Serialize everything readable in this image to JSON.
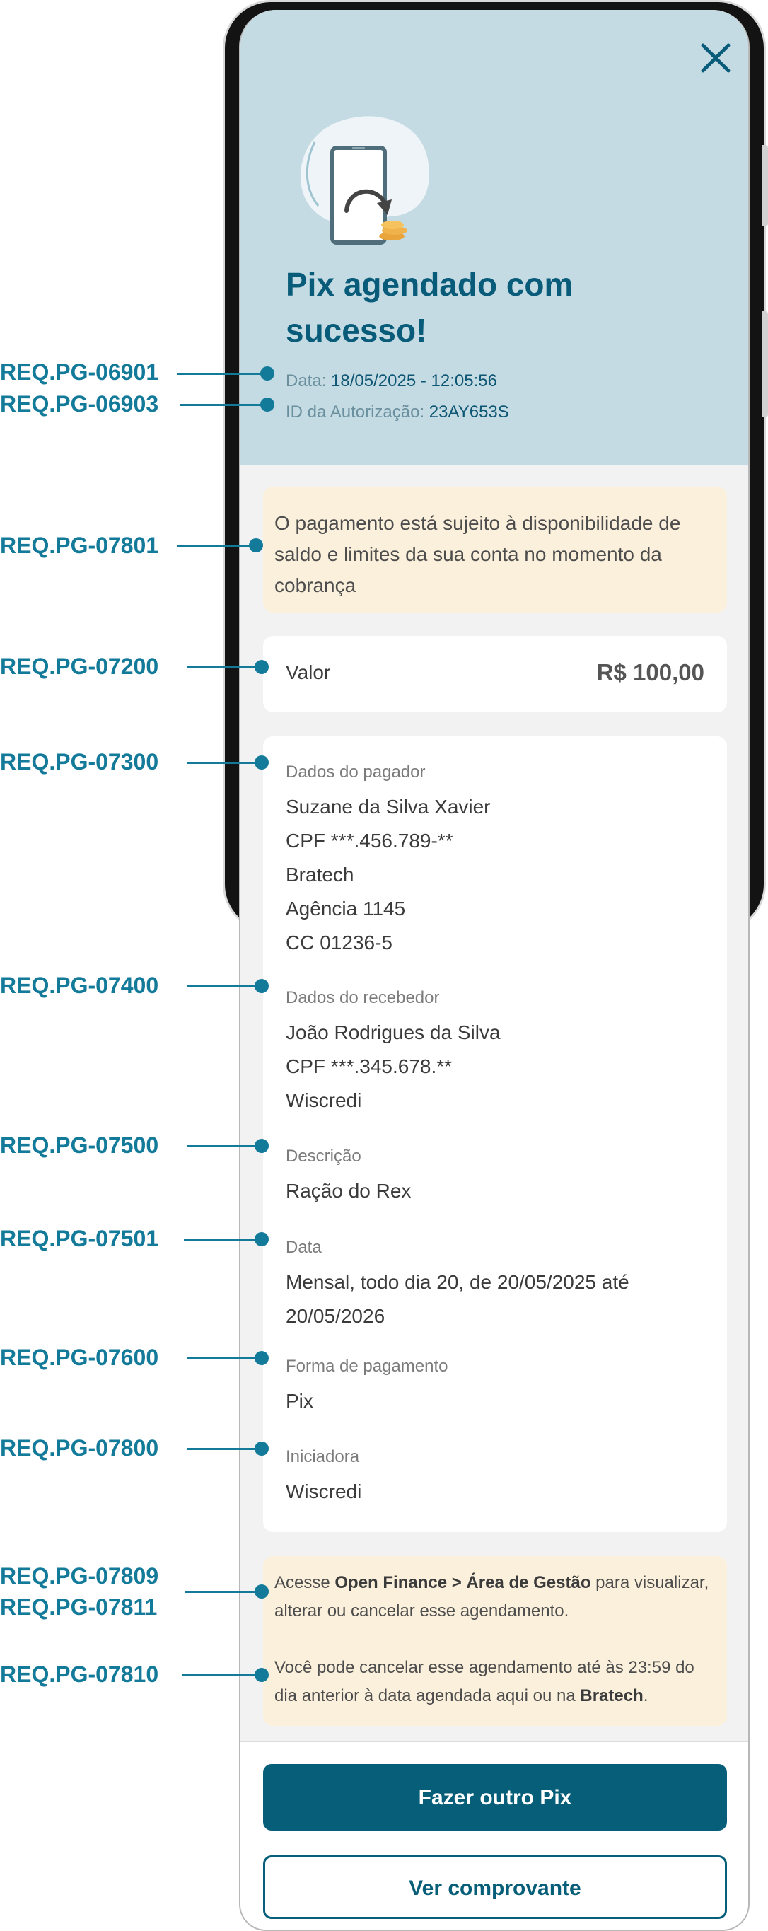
{
  "header": {
    "title": "Pix agendado com sucesso!",
    "date_label": "Data:",
    "date_value": "18/05/2025 - 12:05:56",
    "auth_label": "ID da Autorização:",
    "auth_value": "23AY653S"
  },
  "notice": {
    "text": "O pagamento está sujeito à disponibilidade de saldo e limites da sua conta no momento da cobrança"
  },
  "amount": {
    "label": "Valor",
    "value": "R$ 100,00"
  },
  "details": {
    "payer": {
      "label": "Dados do pagador",
      "lines": [
        "Suzane da Silva Xavier",
        "CPF ***.456.789-**",
        "Bratech",
        "Agência 1145",
        "CC 01236-5"
      ]
    },
    "receiver": {
      "label": "Dados do recebedor",
      "lines": [
        "João Rodrigues da Silva",
        "CPF ***.345.678.**",
        "Wiscredi"
      ]
    },
    "description": {
      "label": "Descrição",
      "value": "Ração do Rex"
    },
    "date": {
      "label": "Data",
      "lines": [
        "Mensal, todo dia 20, de 20/05/2025 até",
        "20/05/2026"
      ]
    },
    "payment_method": {
      "label": "Forma de pagamento",
      "value": "Pix"
    },
    "initiator": {
      "label": "Iniciadora",
      "value": "Wiscredi"
    }
  },
  "info": {
    "p1_before": "Acesse ",
    "p1_bold": "Open Finance > Área de Gestão",
    "p1_after": " para visualizar, alterar ou cancelar esse agendamento.",
    "p2_before": "Você pode cancelar esse agendamento até às 23:59 do dia anterior à data agendada aqui ou na ",
    "p2_bold": "Bratech",
    "p2_after": "."
  },
  "buttons": {
    "primary": "Fazer outro Pix",
    "secondary": "Ver comprovante"
  },
  "annotations": [
    "REQ.PG-06901",
    "REQ.PG-06903",
    "REQ.PG-07801",
    "REQ.PG-07200",
    "REQ.PG-07300",
    "REQ.PG-07400",
    "REQ.PG-07500",
    "REQ.PG-07501",
    "REQ.PG-07600",
    "REQ.PG-07800",
    "REQ.PG-07809",
    "REQ.PG-07811",
    "REQ.PG-07810"
  ],
  "colors": {
    "brand_primary": "#065e79",
    "header_background": "#c5dbe3",
    "notice_background": "#fbf0db",
    "annotation": "#137a9a"
  },
  "icons": {
    "close": "close-icon",
    "illustration": "phone-payment-illustration"
  }
}
